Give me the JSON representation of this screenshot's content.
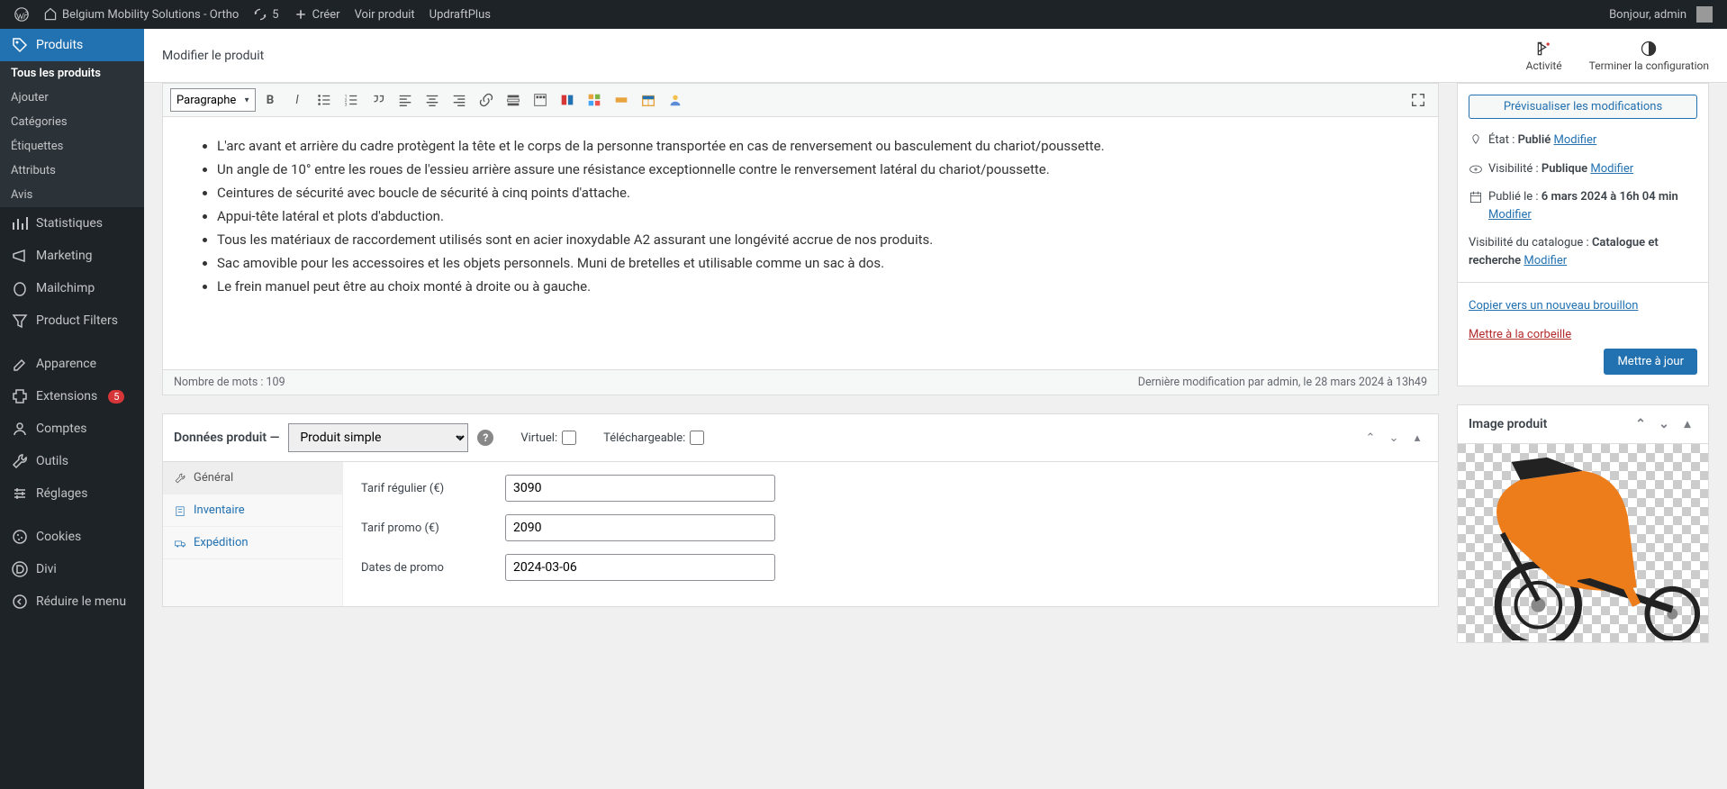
{
  "adminbar": {
    "site": "Belgium Mobility Solutions - Ortho",
    "updates": "5",
    "create": "Créer",
    "view_product": "Voir produit",
    "updraft": "UpdraftPlus",
    "greeting": "Bonjour, admin"
  },
  "sidebar": {
    "produits": "Produits",
    "tous": "Tous les produits",
    "ajouter": "Ajouter",
    "categories": "Catégories",
    "etiquettes": "Étiquettes",
    "attributs": "Attributs",
    "avis": "Avis",
    "stats": "Statistiques",
    "marketing": "Marketing",
    "mailchimp": "Mailchimp",
    "filters": "Product Filters",
    "apparence": "Apparence",
    "extensions": "Extensions",
    "ext_badge": "5",
    "comptes": "Comptes",
    "outils": "Outils",
    "reglages": "Réglages",
    "cookies": "Cookies",
    "divi": "Divi",
    "collapse": "Réduire le menu"
  },
  "header": {
    "title": "Modifier le produit",
    "activity": "Activité",
    "finish": "Terminer la configuration"
  },
  "editor": {
    "format": "Paragraphe",
    "bullets": [
      "L'arc avant et arrière du cadre protègent la tête et le corps de la personne transportée en cas de renversement ou basculement du chariot/poussette.",
      "Un angle de 10° entre les roues de l'essieu arrière assure une résistance exceptionnelle contre le renversement latéral du chariot/poussette.",
      "Ceintures de sécurité avec boucle de sécurité à cinq points d'attache.",
      "Appui-tête latéral et plots d'abduction.",
      "Tous les matériaux de raccordement utilisés sont en acier inoxydable A2 assurant une longévité accrue de nos produits.",
      "Sac amovible pour les accessoires et les objets personnels. Muni de bretelles et utilisable comme un sac à dos.",
      "Le frein manuel peut être au choix monté à droite ou à gauche."
    ],
    "wordcount": "Nombre de mots : 109",
    "lastedit": "Dernière modification par admin, le 28 mars 2024 à 13h49"
  },
  "product_data": {
    "title": "Données produit —",
    "type": "Produit simple",
    "virtual": "Virtuel:",
    "downloadable": "Téléchargeable:",
    "tab_general": "Général",
    "tab_inventory": "Inventaire",
    "tab_shipping": "Expédition",
    "regular_price_label": "Tarif régulier (€)",
    "regular_price": "3090",
    "sale_price_label": "Tarif promo (€)",
    "sale_price": "2090",
    "sale_dates_label": "Dates de promo",
    "sale_date_from": "2024-03-06"
  },
  "publish": {
    "preview": "Prévisualiser les modifications",
    "status_label": "État :",
    "status_value": "Publié",
    "edit": "Modifier",
    "visibility_label": "Visibilité :",
    "visibility_value": "Publique",
    "published_label": "Publié le :",
    "published_value": "6 mars 2024 à 16h 04 min",
    "catalog_label": "Visibilité du catalogue :",
    "catalog_value": "Catalogue et recherche",
    "copy": "Copier vers un nouveau brouillon",
    "trash": "Mettre à la corbeille",
    "update": "Mettre à jour"
  },
  "image_box": {
    "title": "Image produit"
  }
}
